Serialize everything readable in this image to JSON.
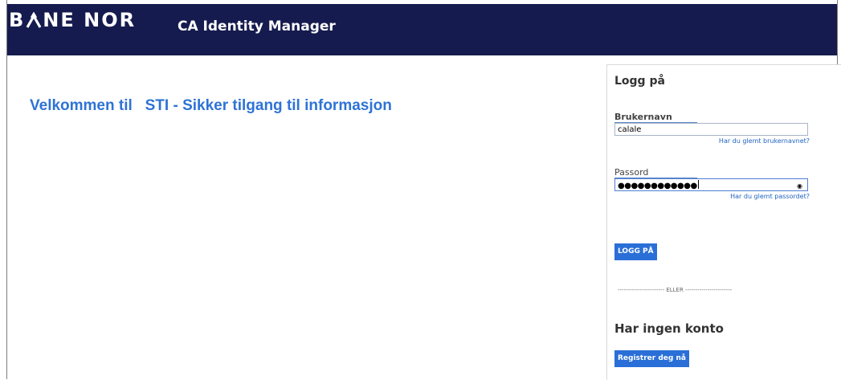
{
  "header": {
    "logo_left": "B",
    "logo_right": "NE NOR",
    "title": "CA Identity Manager"
  },
  "main": {
    "welcome_prefix": "Velkommen til",
    "welcome_name": "STI - Sikker tilgang til informasjon"
  },
  "login": {
    "heading": "Logg på",
    "username_label": "Brukernavn",
    "username_value": "calale",
    "forgot_username": "Har du glemt brukernavnet?",
    "password_label": "Passord",
    "password_masked": "●●●●●●●●●●●●",
    "forgot_password": "Har du glemt passordet?",
    "submit_label": "LOGG PÅ",
    "divider": "----------------------- ELLER -----------------------"
  },
  "register": {
    "heading": "Har ingen konto",
    "button_label": "Registrer deg nå"
  },
  "colors": {
    "header_bg": "#151b4e",
    "accent": "#2a6fd7",
    "welcome_text": "#2e73d6",
    "link": "#1f63c0"
  }
}
